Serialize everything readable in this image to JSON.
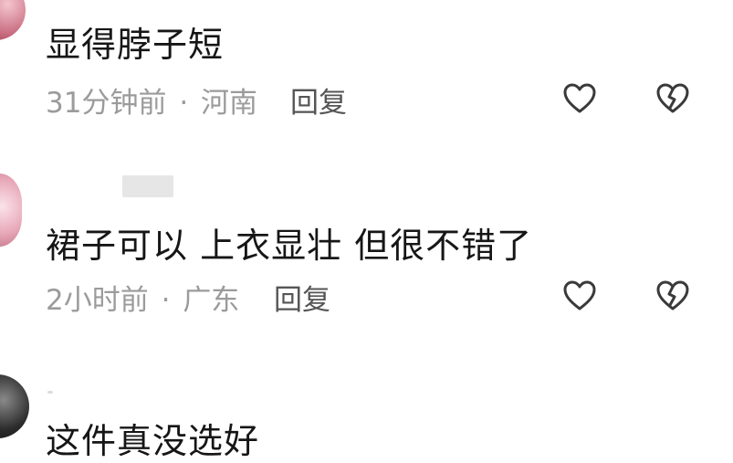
{
  "comments": [
    {
      "text": "显得脖子短",
      "time": "31分钟前",
      "separator": "·",
      "location": "河南",
      "reply_label": "回复",
      "avatar_color": "#c86a7e"
    },
    {
      "text": "裙子可以 上衣显壮 但很不错了",
      "time": "2小时前",
      "separator": "·",
      "location": "广东",
      "reply_label": "回复",
      "avatar_color": "#e7a7b8"
    },
    {
      "text": "这件真没选好",
      "avatar_color": "#2b2b2b"
    }
  ],
  "icons": {
    "like": "heart-icon",
    "dislike": "broken-heart-icon"
  },
  "colors": {
    "text": "#161616",
    "meta": "#9b9b9b",
    "icon_stroke": "#3a3a3a"
  }
}
